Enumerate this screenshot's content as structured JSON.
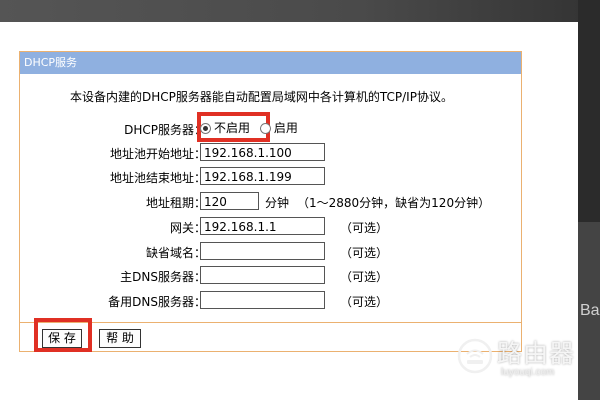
{
  "panel": {
    "title": "DHCP服务",
    "intro": "本设备内建的DHCP服务器能自动配置局域网中各计算机的TCP/IP协议。"
  },
  "form": {
    "dhcp_server_label": "DHCP服务器：",
    "dhcp_options": [
      {
        "label": "不启用",
        "selected": true
      },
      {
        "label": "启用",
        "selected": false
      }
    ],
    "pool_start_label": "地址池开始地址：",
    "pool_start_value": "192.168.1.100",
    "pool_end_label": "地址池结束地址：",
    "pool_end_value": "192.168.1.199",
    "lease_label": "地址租期：",
    "lease_value": "120",
    "lease_unit": "分钟",
    "lease_hint": "（1～2880分钟，缺省为120分钟）",
    "gateway_label": "网关：",
    "gateway_value": "192.168.1.1",
    "optional_text": "（可选）",
    "domain_label": "缺省域名：",
    "domain_value": "",
    "dns_primary_label": "主DNS服务器：",
    "dns_primary_value": "",
    "dns_backup_label": "备用DNS服务器：",
    "dns_backup_value": ""
  },
  "buttons": {
    "save": "保 存",
    "help": "帮 助"
  },
  "watermark": {
    "brand": "路由器",
    "site": "luyouqi.com",
    "side_text": "Ba"
  },
  "colors": {
    "header": "#8fb0e0",
    "border": "#ebb170",
    "highlight": "#e03024"
  }
}
